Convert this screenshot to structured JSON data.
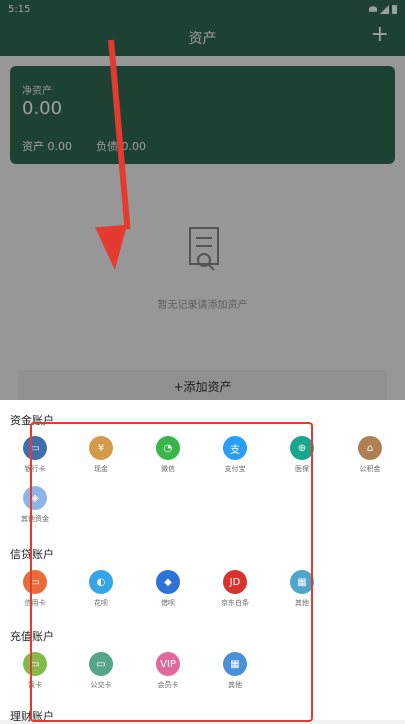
{
  "status_bar": {
    "time": "5:15"
  },
  "header": {
    "title": "资产",
    "add_icon": "+"
  },
  "asset_card": {
    "net_assets_label": "净资产",
    "net_assets_value": "0.00",
    "assets_label": "资产",
    "assets_value": "0.00",
    "liabilities_label": "负债",
    "liabilities_value": "0.00"
  },
  "empty_state": {
    "text": "暂无记录请添加资产"
  },
  "add_asset_button": {
    "label": "+添加资产"
  },
  "sections": [
    {
      "title": "资金账户",
      "items": [
        {
          "label": "银行卡",
          "color": "#3f6ea8",
          "icon": "bank-card-icon",
          "glyph": "▭"
        },
        {
          "label": "现金",
          "color": "#d39a4a",
          "icon": "cash-icon",
          "glyph": "¥"
        },
        {
          "label": "微信",
          "color": "#39b54a",
          "icon": "wechat-icon",
          "glyph": "◔"
        },
        {
          "label": "支付宝",
          "color": "#2a9df4",
          "icon": "alipay-icon",
          "glyph": "支"
        },
        {
          "label": "医保",
          "color": "#1aa68a",
          "icon": "medical-insurance-icon",
          "glyph": "⊕"
        },
        {
          "label": "公积金",
          "color": "#b07f54",
          "icon": "housing-fund-icon",
          "glyph": "⌂"
        },
        {
          "label": "其他资金",
          "color": "#8db4e6",
          "icon": "other-funds-icon",
          "glyph": "◈"
        }
      ]
    },
    {
      "title": "信贷账户",
      "items": [
        {
          "label": "信用卡",
          "color": "#e86b3a",
          "icon": "credit-card-icon",
          "glyph": "▭"
        },
        {
          "label": "花呗",
          "color": "#34a6e8",
          "icon": "huabei-icon",
          "glyph": "◐"
        },
        {
          "label": "借呗",
          "color": "#2f73d6",
          "icon": "jiebei-icon",
          "glyph": "◆"
        },
        {
          "label": "京东白条",
          "color": "#d8332d",
          "icon": "jd-baitiao-icon",
          "glyph": "JD"
        },
        {
          "label": "其他",
          "color": "#4fa6c9",
          "icon": "other-credit-icon",
          "glyph": "▦"
        }
      ]
    },
    {
      "title": "充值账户",
      "items": [
        {
          "label": "饭卡",
          "color": "#84b94b",
          "icon": "meal-card-icon",
          "glyph": "▭"
        },
        {
          "label": "公交卡",
          "color": "#55a48c",
          "icon": "transit-card-icon",
          "glyph": "▭"
        },
        {
          "label": "会员卡",
          "color": "#e06aa0",
          "icon": "member-card-icon",
          "glyph": "VIP"
        },
        {
          "label": "其他",
          "color": "#4a8fd8",
          "icon": "other-recharge-icon",
          "glyph": "▦"
        }
      ]
    },
    {
      "title": "理财账户",
      "items": []
    }
  ]
}
